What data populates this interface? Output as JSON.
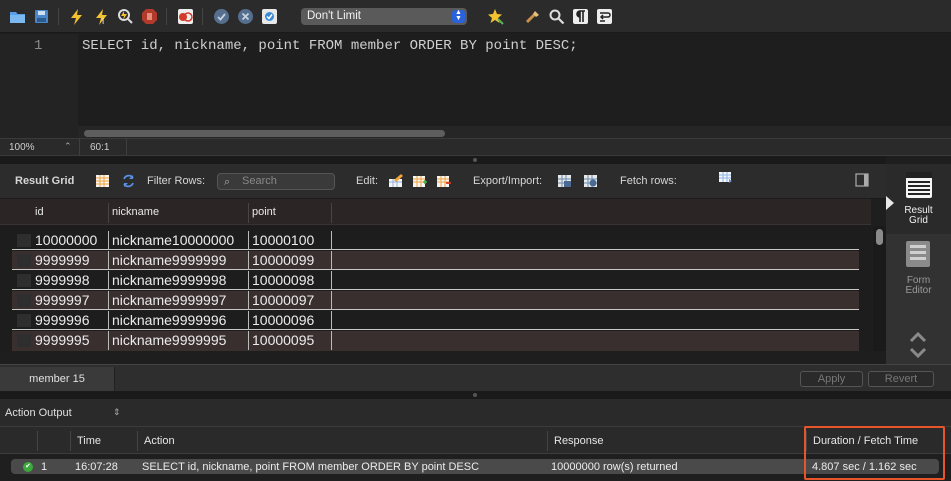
{
  "toolbar": {
    "limit_select_value": "Don't Limit",
    "icons": [
      "open-folder-icon",
      "save-icon",
      "execute-icon",
      "execute-current-icon",
      "explain-icon",
      "stop-icon",
      "toggle-error-icon",
      "commit-icon",
      "rollback-icon",
      "autocommit-icon",
      "beautify-icon",
      "find-icon",
      "invisible-chars-icon",
      "wrap-icon"
    ]
  },
  "editor": {
    "line_number": "1",
    "sql": "SELECT id, nickname, point FROM member ORDER BY point DESC;"
  },
  "statusbar": {
    "zoom": "100%",
    "cursor_position": "60:1"
  },
  "result_toolbar": {
    "result_grid_label": "Result Grid",
    "filter_rows_label": "Filter Rows:",
    "search_placeholder": "Search",
    "edit_label": "Edit:",
    "export_import_label": "Export/Import:",
    "fetch_rows_label": "Fetch rows:"
  },
  "grid": {
    "columns": [
      "id",
      "nickname",
      "point"
    ],
    "rows": [
      [
        "10000000",
        "nickname10000000",
        "10000100"
      ],
      [
        "9999999",
        "nickname9999999",
        "10000099"
      ],
      [
        "9999998",
        "nickname9999998",
        "10000098"
      ],
      [
        "9999997",
        "nickname9999997",
        "10000097"
      ],
      [
        "9999996",
        "nickname9999996",
        "10000096"
      ],
      [
        "9999995",
        "nickname9999995",
        "10000095"
      ]
    ]
  },
  "side_panel": {
    "result_grid": {
      "line1": "Result",
      "line2": "Grid"
    },
    "form_editor": {
      "line1": "Form",
      "line2": "Editor"
    }
  },
  "tabs": {
    "active_tab": "member 15",
    "apply_label": "Apply",
    "revert_label": "Revert"
  },
  "action_output": {
    "title": "Action Output",
    "columns": {
      "time": "Time",
      "action": "Action",
      "response": "Response",
      "duration": "Duration / Fetch Time"
    },
    "row": {
      "index": "1",
      "time": "16:07:28",
      "action": "SELECT id, nickname, point FROM member ORDER BY point DESC",
      "response": "10000000 row(s) returned",
      "duration": "4.807 sec / 1.162 sec"
    }
  },
  "colors": {
    "highlight": "#e8552a",
    "status_ok": "#3caa3c",
    "stepper_blue": "#2a62d9"
  }
}
